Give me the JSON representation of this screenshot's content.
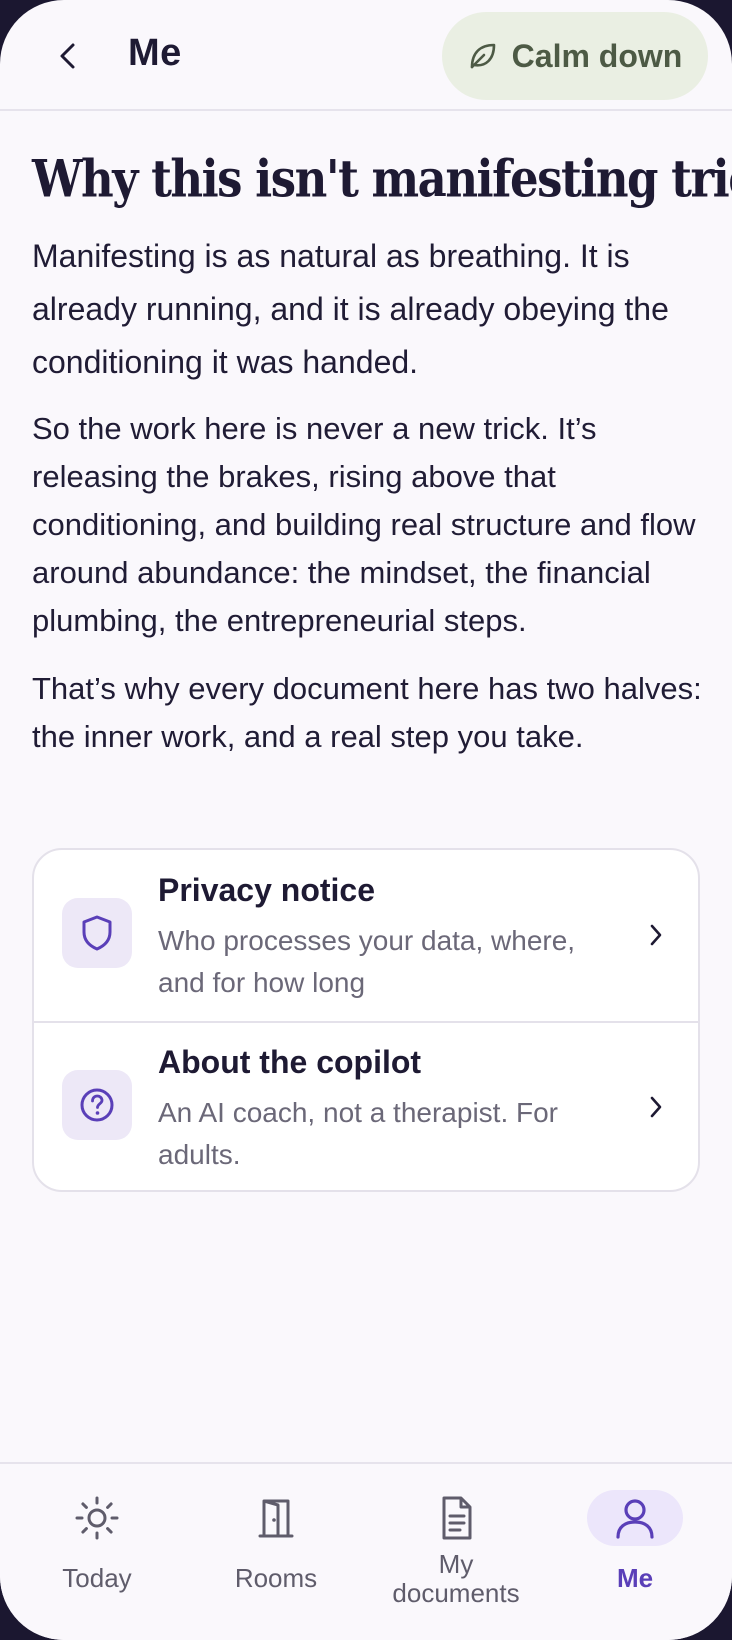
{
  "header": {
    "title": "Me",
    "calm_label": "Calm down"
  },
  "article": {
    "title": "Why this isn't manifesting tricks",
    "paragraphs": [
      "Manifesting is as natural as breathing. It is already running, and it is already obeying the conditioning it was handed.",
      "So the work here is never a new trick. It’s releasing the brakes, rising above that conditioning, and building real structure and flow around abundance: the mindset, the financial plumbing, the entrepreneurial steps.",
      "That’s why every document here has two halves: the inner work, and a real step you take."
    ]
  },
  "links": [
    {
      "title": "Privacy notice",
      "subtitle": "Who processes your data, where, and for how long",
      "icon": "shield-icon"
    },
    {
      "title": "About the copilot",
      "subtitle": "An AI coach, not a therapist. For adults.",
      "icon": "question-circle-icon"
    }
  ],
  "nav": {
    "items": [
      {
        "label": "Today",
        "icon": "sun-icon",
        "active": false
      },
      {
        "label": "Rooms",
        "icon": "door-icon",
        "active": false
      },
      {
        "label": "My documents",
        "icon": "document-icon",
        "active": false
      },
      {
        "label": "Me",
        "icon": "person-icon",
        "active": true
      }
    ]
  },
  "colors": {
    "accent": "#5a3fb8",
    "calm_bg": "#eaefe3",
    "icon_bg": "#ede8f7",
    "text": "#1e1a33"
  }
}
